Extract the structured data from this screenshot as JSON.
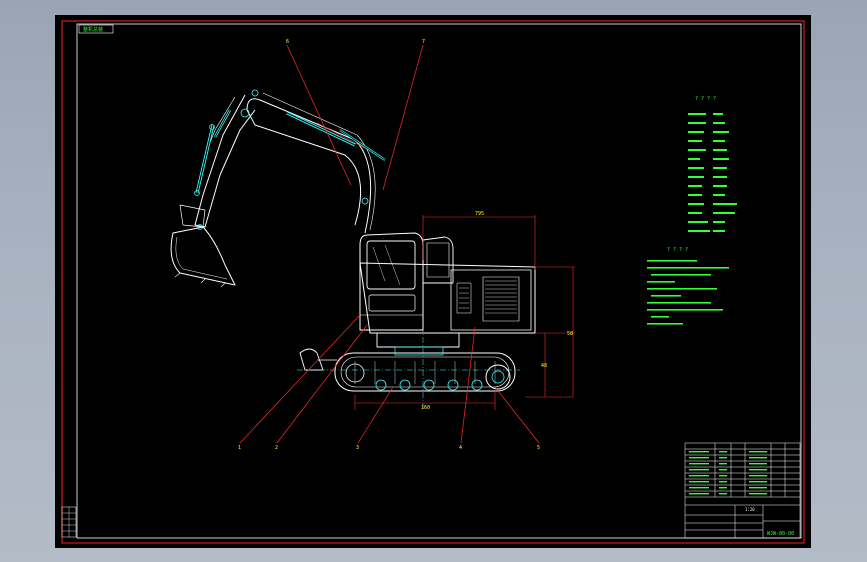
{
  "drawing": {
    "title_tag": "整机总装",
    "tech_params_heading": "? ? ? ?",
    "notes_heading": "? ? ? ?",
    "title_block_code": "WJW-80-00",
    "title_block_sub": "1:20",
    "callouts": [
      "1",
      "2",
      "3",
      "4",
      "5",
      "6",
      "7"
    ]
  },
  "colors": {
    "frame": "#ff2020",
    "cad_white": "#ffffff",
    "cad_cyan": "#33ffff",
    "cad_green": "#33ff33",
    "cad_yellow": "#ffff33",
    "cad_red": "#ff2a2a"
  }
}
